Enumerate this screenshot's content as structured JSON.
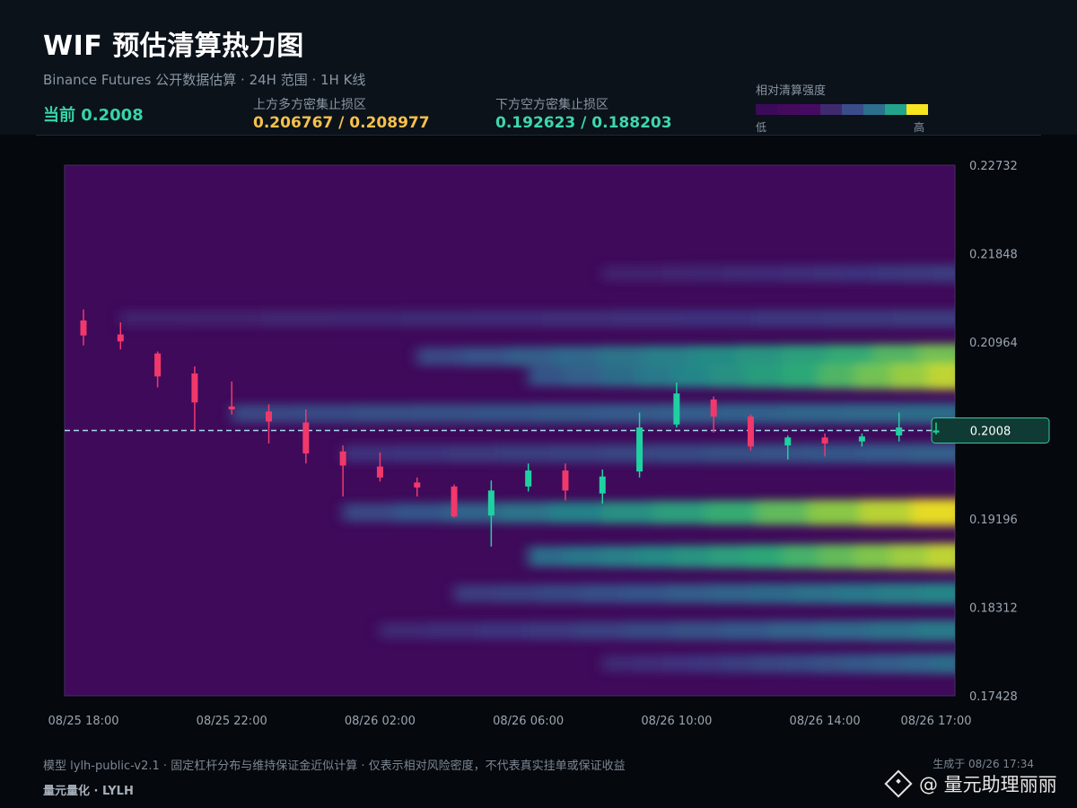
{
  "header": {
    "title": "WIF 预估清算热力图",
    "subtitle": "Binance Futures 公开数据估算 · 24H 范围 · 1H K线",
    "current": "当前 0.2008",
    "upper_label": "上方多方密集止损区",
    "upper_value": "0.206767 / 0.208977",
    "lower_label": "下方空方密集止损区",
    "lower_value": "0.192623 / 0.188203",
    "colorbar_title": "相对清算强度",
    "colorbar_low": "低",
    "colorbar_high": "高",
    "colorbar_colors": [
      "#3b0a59",
      "#440a5c",
      "#450b63",
      "#3f2a70",
      "#3b4c8a",
      "#2c6f8e",
      "#23a38a",
      "#f6e51f"
    ]
  },
  "footer": {
    "note": "模型 lylh-public-v2.1 · 固定杠杆分布与维持保证金近似计算 · 仅表示相对风险密度，不代表真实挂单或保证收益",
    "brand": "量元量化 · LYLH",
    "generated": "生成于 08/26 17:34",
    "watermark": "@ 量元助理丽丽"
  },
  "chart_data": {
    "type": "heatmap",
    "title": "WIF 预估清算热力图",
    "ylim": [
      0.17428,
      0.22732
    ],
    "y_ticks": [
      "0.22732",
      "0.21848",
      "0.20964",
      "0.20080",
      "0.19196",
      "0.18312",
      "0.17428"
    ],
    "y_tick_labels": [
      "0.22732",
      "0.21848",
      "0.20964",
      "0.19196",
      "0.18312",
      "0.17428"
    ],
    "x_ticks": [
      "08/25 18:00",
      "08/25 22:00",
      "08/26 02:00",
      "08/26 06:00",
      "08/26 10:00",
      "08/26 14:00",
      "08/26 17:00"
    ],
    "x_range": [
      "08/25 18:00",
      "08/26 17:00"
    ],
    "current_price": 0.2008,
    "current_price_label": "0.2008",
    "heat_bands": [
      {
        "price": 0.2082,
        "x_start": "08/26 03:00",
        "intensity_start": 0.35,
        "intensity_end": 0.85
      },
      {
        "price": 0.2062,
        "x_start": "08/26 06:00",
        "intensity_start": 0.4,
        "intensity_end": 0.95
      },
      {
        "price": 0.2025,
        "x_start": "08/25 22:00",
        "intensity_start": 0.35,
        "intensity_end": 0.5
      },
      {
        "price": 0.1985,
        "x_start": "08/26 01:00",
        "intensity_start": 0.25,
        "intensity_end": 0.45
      },
      {
        "price": 0.1926,
        "x_start": "08/26 01:00",
        "intensity_start": 0.35,
        "intensity_end": 1.0
      },
      {
        "price": 0.1882,
        "x_start": "08/26 06:00",
        "intensity_start": 0.5,
        "intensity_end": 0.95
      },
      {
        "price": 0.1845,
        "x_start": "08/26 04:00",
        "intensity_start": 0.3,
        "intensity_end": 0.6
      },
      {
        "price": 0.1808,
        "x_start": "08/26 02:00",
        "intensity_start": 0.2,
        "intensity_end": 0.55
      },
      {
        "price": 0.212,
        "x_start": "08/25 19:00",
        "intensity_start": 0.15,
        "intensity_end": 0.3
      },
      {
        "price": 0.2165,
        "x_start": "08/26 08:00",
        "intensity_start": 0.15,
        "intensity_end": 0.3
      },
      {
        "price": 0.1775,
        "x_start": "08/26 08:00",
        "intensity_start": 0.2,
        "intensity_end": 0.5
      }
    ],
    "candles": [
      {
        "t": "08/25 18:00",
        "o": 0.2118,
        "h": 0.2129,
        "l": 0.2093,
        "c": 0.2103
      },
      {
        "t": "08/25 19:00",
        "o": 0.2104,
        "h": 0.2116,
        "l": 0.2089,
        "c": 0.2097
      },
      {
        "t": "08/25 20:00",
        "o": 0.2085,
        "h": 0.2087,
        "l": 0.2051,
        "c": 0.2062
      },
      {
        "t": "08/25 21:00",
        "o": 0.2065,
        "h": 0.2072,
        "l": 0.2008,
        "c": 0.2036
      },
      {
        "t": "08/25 22:00",
        "o": 0.2032,
        "h": 0.2057,
        "l": 0.2024,
        "c": 0.2029
      },
      {
        "t": "08/25 23:00",
        "o": 0.2027,
        "h": 0.2034,
        "l": 0.1995,
        "c": 0.2017
      },
      {
        "t": "08/26 00:00",
        "o": 0.2016,
        "h": 0.2029,
        "l": 0.1975,
        "c": 0.1985
      },
      {
        "t": "08/26 01:00",
        "o": 0.1987,
        "h": 0.1993,
        "l": 0.1942,
        "c": 0.1973
      },
      {
        "t": "08/26 02:00",
        "o": 0.1972,
        "h": 0.1986,
        "l": 0.1957,
        "c": 0.1961
      },
      {
        "t": "08/26 03:00",
        "o": 0.1956,
        "h": 0.1961,
        "l": 0.1942,
        "c": 0.1951
      },
      {
        "t": "08/26 04:00",
        "o": 0.1952,
        "h": 0.1954,
        "l": 0.1921,
        "c": 0.1922
      },
      {
        "t": "08/26 05:00",
        "o": 0.1923,
        "h": 0.1958,
        "l": 0.1892,
        "c": 0.1948
      },
      {
        "t": "08/26 06:00",
        "o": 0.1952,
        "h": 0.1975,
        "l": 0.1947,
        "c": 0.1968
      },
      {
        "t": "08/26 07:00",
        "o": 0.1968,
        "h": 0.1975,
        "l": 0.1938,
        "c": 0.1948
      },
      {
        "t": "08/26 08:00",
        "o": 0.1945,
        "h": 0.1969,
        "l": 0.1935,
        "c": 0.1962
      },
      {
        "t": "08/26 09:00",
        "o": 0.1967,
        "h": 0.2026,
        "l": 0.1961,
        "c": 0.2011
      },
      {
        "t": "08/26 10:00",
        "o": 0.2014,
        "h": 0.2056,
        "l": 0.2011,
        "c": 0.2045
      },
      {
        "t": "08/26 11:00",
        "o": 0.2039,
        "h": 0.2042,
        "l": 0.2006,
        "c": 0.2022
      },
      {
        "t": "08/26 12:00",
        "o": 0.2022,
        "h": 0.2024,
        "l": 0.1988,
        "c": 0.1992
      },
      {
        "t": "08/26 13:00",
        "o": 0.1993,
        "h": 0.2003,
        "l": 0.1979,
        "c": 0.2001
      },
      {
        "t": "08/26 14:00",
        "o": 0.2001,
        "h": 0.2005,
        "l": 0.1982,
        "c": 0.1995
      },
      {
        "t": "08/26 15:00",
        "o": 0.1997,
        "h": 0.2005,
        "l": 0.1992,
        "c": 0.2002
      },
      {
        "t": "08/26 16:00",
        "o": 0.2003,
        "h": 0.2026,
        "l": 0.1997,
        "c": 0.2011
      },
      {
        "t": "08/26 17:00",
        "o": 0.2006,
        "h": 0.2016,
        "l": 0.2004,
        "c": 0.2008
      }
    ],
    "up_color": "#1fd1a0",
    "down_color": "#f0386b",
    "grid": false
  }
}
